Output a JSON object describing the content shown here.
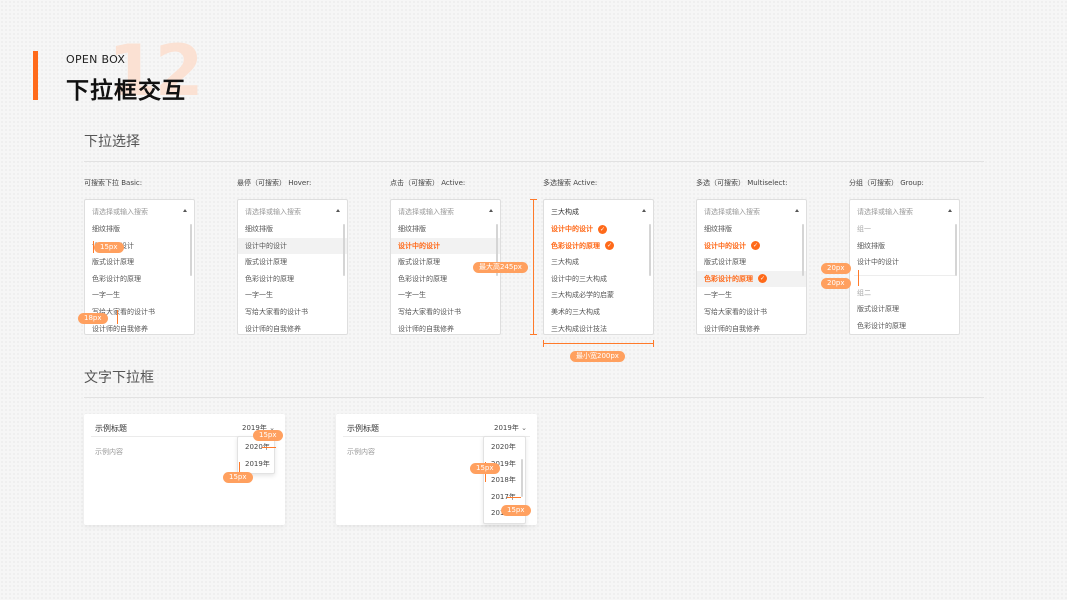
{
  "header": {
    "bg_number": "12",
    "eyebrow": "OPEN BOX",
    "title": "下拉框交互"
  },
  "section1": {
    "title": "下拉选择"
  },
  "section2": {
    "title": "文字下拉框"
  },
  "colors": {
    "accent": "#ff6a1a",
    "pill": "#ffa05f"
  },
  "columns": [
    {
      "label": "可搜索下拉 Basic:",
      "head": "请选择或输入搜索",
      "items": [
        "细纹排版",
        "设计中的设计",
        "版式设计原理",
        "色彩设计的原理",
        "一字一生",
        "写给大家看的设计书",
        "设计师的自我修养"
      ]
    },
    {
      "label": "悬停（可搜索） Hover:",
      "head": "请选择或输入搜索",
      "items": [
        "细纹排版",
        "设计中的设计",
        "版式设计原理",
        "色彩设计的原理",
        "一字一生",
        "写给大家看的设计书",
        "设计师的自我修养"
      ]
    },
    {
      "label": "点击（可搜索） Active:",
      "head": "请选择或输入搜索",
      "items": [
        "细纹排版",
        "设计中的设计",
        "版式设计原理",
        "色彩设计的原理",
        "一字一生",
        "写给大家看的设计书",
        "设计师的自我修养"
      ]
    },
    {
      "label": "多选搜索 Active:",
      "head": "三大构成",
      "items": [
        "设计中的设计",
        "色彩设计的原理",
        "三大构成",
        "设计中的三大构成",
        "三大构成必学的启蒙",
        "美术的三大构成",
        "三大构成设计技法"
      ]
    },
    {
      "label": "多选（可搜索） Multiselect:",
      "head": "请选择或输入搜索",
      "items": [
        "细纹排版",
        "设计中的设计",
        "版式设计原理",
        "色彩设计的原理",
        "一字一生",
        "写给大家看的设计书",
        "设计师的自我修养"
      ]
    },
    {
      "label": "分组（可搜索） Group:",
      "head": "请选择或输入搜索",
      "items": [
        "组一",
        "细纹排版",
        "设计中的设计",
        "组二",
        "版式设计原理",
        "色彩设计的原理"
      ]
    }
  ],
  "annotations": {
    "p15": "15px",
    "p18": "18px",
    "max_h": "最大高245px",
    "min_w": "最小宽200px",
    "p20": "20px"
  },
  "cards": [
    {
      "title": "示例标题",
      "year": "2019年",
      "body": "示例内容",
      "options": [
        "2020年",
        "2019年"
      ]
    },
    {
      "title": "示例标题",
      "year": "2019年",
      "body": "示例内容",
      "options": [
        "2020年",
        "2019年",
        "2018年",
        "2017年",
        "2016年"
      ]
    }
  ]
}
